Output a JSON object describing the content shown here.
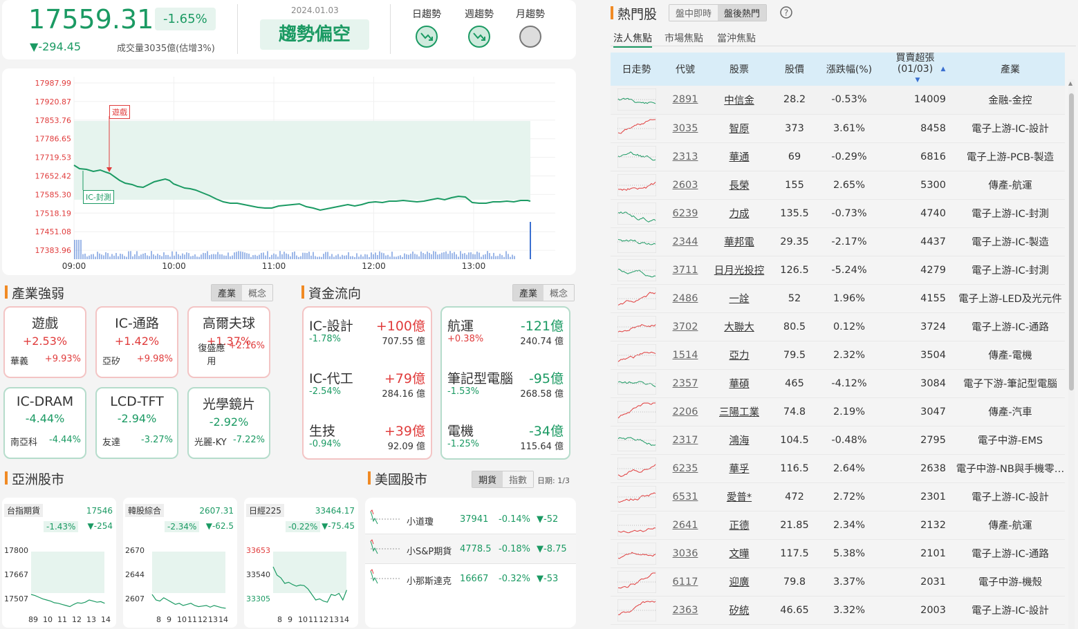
{
  "index": {
    "value": "17559.31",
    "pct": "-1.65%",
    "change": "▼-294.45",
    "volume": "成交量3035億(估增3%)",
    "date": "2024.01.03",
    "trend": "趨勢偏空"
  },
  "trends": [
    {
      "label": "日趨勢"
    },
    {
      "label": "週趨勢"
    },
    {
      "label": "月趨勢"
    }
  ],
  "chart": {
    "yticks": [
      "17987.99",
      "17920.87",
      "17853.76",
      "17786.65",
      "17719.53",
      "17652.42",
      "17585.30",
      "17518.19",
      "17451.08",
      "17383.96"
    ],
    "xticks": [
      "09:00",
      "10:00",
      "11:00",
      "12:00",
      "13:00"
    ],
    "flag_game": "遊戲",
    "flag_ic": "IC-封測"
  },
  "industry": {
    "title": "產業強弱",
    "tabs": [
      "產業",
      "概念"
    ],
    "cards": [
      {
        "name": "遊戲",
        "pct": "+2.53%",
        "stock": "華義",
        "spct": "+9.93%",
        "tone": "r"
      },
      {
        "name": "IC-通路",
        "pct": "+1.42%",
        "stock": "亞矽",
        "spct": "+9.98%",
        "tone": "r"
      },
      {
        "name": "高爾夫球",
        "pct": "+1.37%",
        "stock": "復盛應用",
        "spct": "+2.16%",
        "tone": "r"
      },
      {
        "name": "IC-DRAM",
        "pct": "-4.44%",
        "stock": "南亞科",
        "spct": "-4.44%",
        "tone": "g"
      },
      {
        "name": "LCD-TFT",
        "pct": "-2.94%",
        "stock": "友達",
        "spct": "-3.27%",
        "tone": "g"
      },
      {
        "name": "光學鏡片",
        "pct": "-2.92%",
        "stock": "光麗-KY",
        "spct": "-7.22%",
        "tone": "g"
      }
    ]
  },
  "flow": {
    "title": "資金流向",
    "tabs": [
      "產業",
      "概念"
    ],
    "inflow": [
      {
        "name": "IC-設計",
        "amt": "+100億",
        "pct": "-1.78%",
        "val": "707.55 億"
      },
      {
        "name": "IC-代工",
        "amt": "+79億",
        "pct": "-2.54%",
        "val": "284.16 億"
      },
      {
        "name": "生技",
        "amt": "+39億",
        "pct": "-0.94%",
        "val": "92.09 億"
      }
    ],
    "outflow": [
      {
        "name": "航運",
        "amt": "-121億",
        "pct": "+0.38%",
        "val": "240.74 億"
      },
      {
        "name": "筆記型電腦",
        "amt": "-95億",
        "pct": "-1.53%",
        "val": "268.58 億"
      },
      {
        "name": "電機",
        "amt": "-34億",
        "pct": "-1.25%",
        "val": "115.64 億"
      }
    ]
  },
  "asia": {
    "title": "亞洲股市",
    "markets": [
      {
        "name": "台指期貨",
        "val": "17546",
        "pct": "-1.43%",
        "chg": "▼-254",
        "yl": [
          "17800",
          "17667",
          "17507"
        ],
        "xl": [
          "89",
          "10",
          "11",
          "12",
          "13",
          "14"
        ]
      },
      {
        "name": "韓股綜合",
        "val": "2607.31",
        "pct": "-2.34%",
        "chg": "▼-62.5",
        "yl": [
          "2670",
          "2644",
          "2607"
        ],
        "xl": [
          "8",
          "9",
          "10",
          "11",
          "12",
          "13",
          "14"
        ]
      },
      {
        "name": "日經225",
        "val": "33464.17",
        "pct": "-0.22%",
        "chg": "▼-75.45",
        "yl": [
          "33653",
          "33540",
          "33305"
        ],
        "xl": [
          "8",
          "9",
          "10",
          "11",
          "12",
          "13",
          "14"
        ]
      }
    ]
  },
  "us": {
    "title": "美國股市",
    "tabs": [
      "期貨",
      "指數"
    ],
    "date": "日期: 1/3",
    "rows": [
      {
        "name": "小道瓊",
        "val": "37941",
        "pct": "-0.14%",
        "chg": "▼-52"
      },
      {
        "name": "小S&P期貨",
        "val": "4778.5",
        "pct": "-0.18%",
        "chg": "▼-8.75"
      },
      {
        "name": "小那斯達克",
        "val": "16667",
        "pct": "-0.32%",
        "chg": "▼-53"
      }
    ]
  },
  "hot": {
    "title": "熱門股",
    "modes": [
      "盤中即時",
      "盤後熱門"
    ],
    "tabs": [
      "法人焦點",
      "市場焦點",
      "當沖焦點"
    ],
    "headers": [
      "日走勢",
      "代號",
      "股票",
      "股價",
      "漲跌幅(%)",
      "買賣超張(01/03)",
      "產業"
    ],
    "rows": [
      {
        "code": "2891",
        "name": "中信金",
        "price": "28.2",
        "pct": "-0.53%",
        "net": "14009",
        "ind": "金融-金控",
        "c": "g"
      },
      {
        "code": "3035",
        "name": "智原",
        "price": "373",
        "pct": "3.61%",
        "net": "8458",
        "ind": "電子上游-IC-設計",
        "c": "r"
      },
      {
        "code": "2313",
        "name": "華通",
        "price": "69",
        "pct": "-0.29%",
        "net": "6816",
        "ind": "電子上游-PCB-製造",
        "c": "g"
      },
      {
        "code": "2603",
        "name": "長榮",
        "price": "155",
        "pct": "2.65%",
        "net": "5300",
        "ind": "傳產-航運",
        "c": "r"
      },
      {
        "code": "6239",
        "name": "力成",
        "price": "135.5",
        "pct": "-0.73%",
        "net": "4740",
        "ind": "電子上游-IC-封測",
        "c": "g"
      },
      {
        "code": "2344",
        "name": "華邦電",
        "price": "29.35",
        "pct": "-2.17%",
        "net": "4437",
        "ind": "電子上游-IC-製造",
        "c": "g"
      },
      {
        "code": "3711",
        "name": "日月光投控",
        "price": "126.5",
        "pct": "-5.24%",
        "net": "4279",
        "ind": "電子上游-IC-封測",
        "c": "g"
      },
      {
        "code": "2486",
        "name": "一詮",
        "price": "52",
        "pct": "1.96%",
        "net": "4155",
        "ind": "電子上游-LED及光元件",
        "c": "r"
      },
      {
        "code": "3702",
        "name": "大聯大",
        "price": "80.5",
        "pct": "0.12%",
        "net": "3724",
        "ind": "電子上游-IC-通路",
        "c": "r"
      },
      {
        "code": "1514",
        "name": "亞力",
        "price": "79.5",
        "pct": "2.32%",
        "net": "3504",
        "ind": "傳產-電機",
        "c": "r"
      },
      {
        "code": "2357",
        "name": "華碩",
        "price": "465",
        "pct": "-4.12%",
        "net": "3084",
        "ind": "電子下游-筆記型電腦",
        "c": "g"
      },
      {
        "code": "2206",
        "name": "三陽工業",
        "price": "74.8",
        "pct": "2.19%",
        "net": "3047",
        "ind": "傳產-汽車",
        "c": "r"
      },
      {
        "code": "2317",
        "name": "鴻海",
        "price": "104.5",
        "pct": "-0.48%",
        "net": "2795",
        "ind": "電子中游-EMS",
        "c": "g"
      },
      {
        "code": "6235",
        "name": "華孚",
        "price": "116.5",
        "pct": "2.64%",
        "net": "2638",
        "ind": "電子中游-NB與手機零…",
        "c": "r"
      },
      {
        "code": "6531",
        "name": "愛普*",
        "price": "472",
        "pct": "2.72%",
        "net": "2301",
        "ind": "電子上游-IC-設計",
        "c": "r"
      },
      {
        "code": "2641",
        "name": "正德",
        "price": "21.85",
        "pct": "2.34%",
        "net": "2132",
        "ind": "傳產-航運",
        "c": "r"
      },
      {
        "code": "3036",
        "name": "文曄",
        "price": "117.5",
        "pct": "5.38%",
        "net": "2101",
        "ind": "電子上游-IC-通路",
        "c": "r"
      },
      {
        "code": "6117",
        "name": "迎廣",
        "price": "79.8",
        "pct": "3.37%",
        "net": "2031",
        "ind": "電子中游-機殼",
        "c": "r"
      },
      {
        "code": "2363",
        "name": "矽統",
        "price": "46.65",
        "pct": "3.32%",
        "net": "2003",
        "ind": "電子上游-IC-設計",
        "c": "r"
      }
    ]
  }
}
